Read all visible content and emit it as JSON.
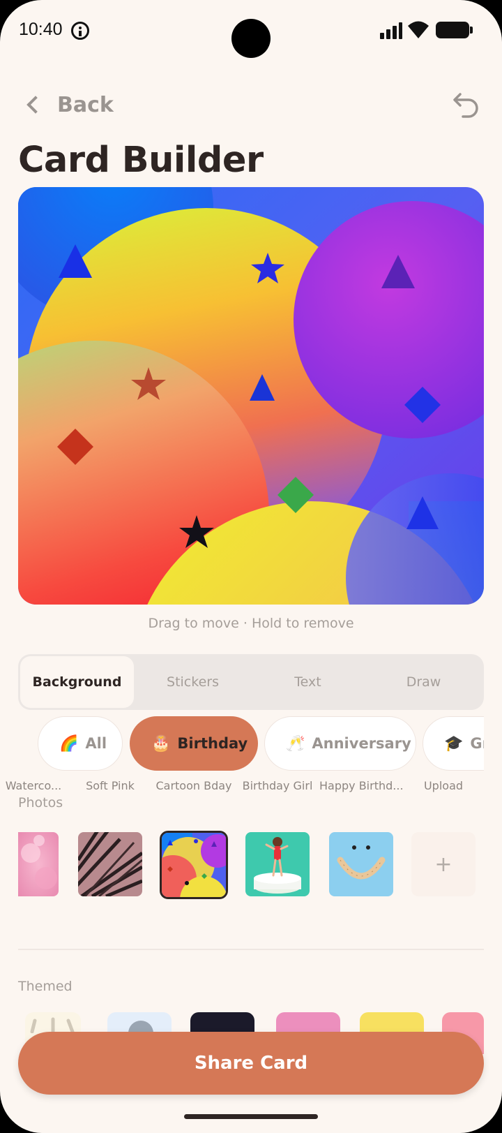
{
  "status": {
    "time": "10:40"
  },
  "header": {
    "back_label": "Back",
    "title": "Card Builder"
  },
  "canvas": {
    "hint": "Drag to move · Hold to remove",
    "background_name": "Cartoon Bday"
  },
  "tabs": [
    {
      "label": "Background",
      "active": true
    },
    {
      "label": "Stickers",
      "active": false
    },
    {
      "label": "Text",
      "active": false
    },
    {
      "label": "Draw",
      "active": false
    }
  ],
  "chips": [
    {
      "emoji": "🌈",
      "label": "All",
      "active": false
    },
    {
      "emoji": "🎂",
      "label": "Birthday",
      "active": true
    },
    {
      "emoji": "🥂",
      "label": "Anniversary",
      "active": false
    },
    {
      "emoji": "🎓",
      "label": "Gra",
      "active": false
    }
  ],
  "photos": {
    "section_label": "Photos",
    "items": [
      {
        "label": "Waterco...",
        "selected": false
      },
      {
        "label": "Soft Pink",
        "selected": false
      },
      {
        "label": "Cartoon Bday",
        "selected": true
      },
      {
        "label": "Birthday Girl",
        "selected": false
      },
      {
        "label": "Happy Birthd...",
        "selected": false
      }
    ],
    "upload_label": "Upload",
    "upload_icon": "+"
  },
  "themed": {
    "section_label": "Themed"
  },
  "share_label": "Share Card",
  "colors": {
    "accent": "#d57856",
    "background": "#fcf6f1",
    "text": "#2e2523",
    "muted": "#a59e99"
  }
}
